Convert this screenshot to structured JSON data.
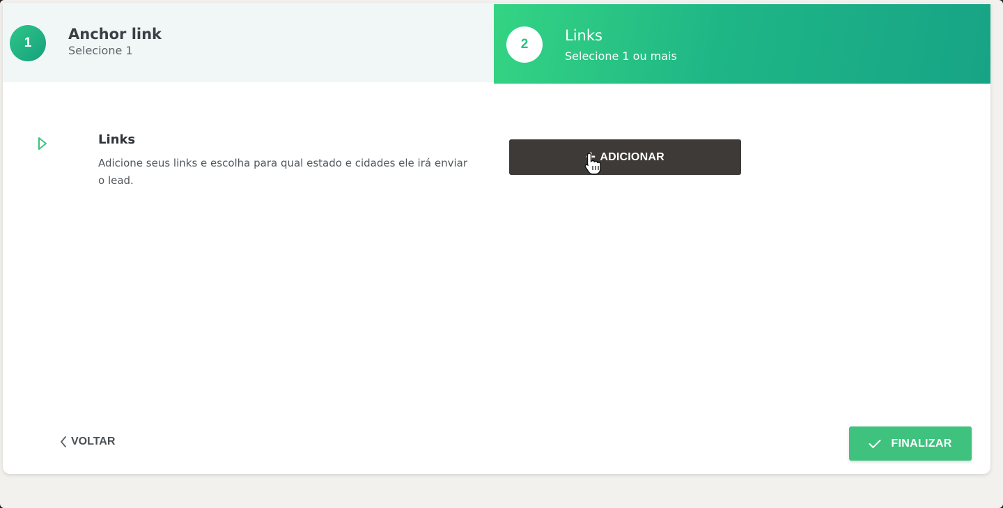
{
  "stepper": {
    "steps": [
      {
        "number": "1",
        "title": "Anchor link",
        "subtitle": "Selecione 1"
      },
      {
        "number": "2",
        "title": "Links",
        "subtitle": "Selecione 1 ou mais"
      }
    ]
  },
  "section": {
    "title": "Links",
    "description": "Adicione seus links e escolha para qual estado e cidades ele irá enviar o lead.",
    "icon": "play-outline-icon"
  },
  "add_button": {
    "label": "ADICIONAR",
    "icon": "plus-icon"
  },
  "footer": {
    "back_label": "VOLTAR",
    "back_icon": "chevron-left-icon",
    "finish_label": "FINALIZAR",
    "finish_icon": "check-icon"
  },
  "colors": {
    "accent_green": "#3ec27e",
    "gradient_start": "#34d483",
    "gradient_end": "#17a486",
    "dark_button": "#3d3a37"
  }
}
